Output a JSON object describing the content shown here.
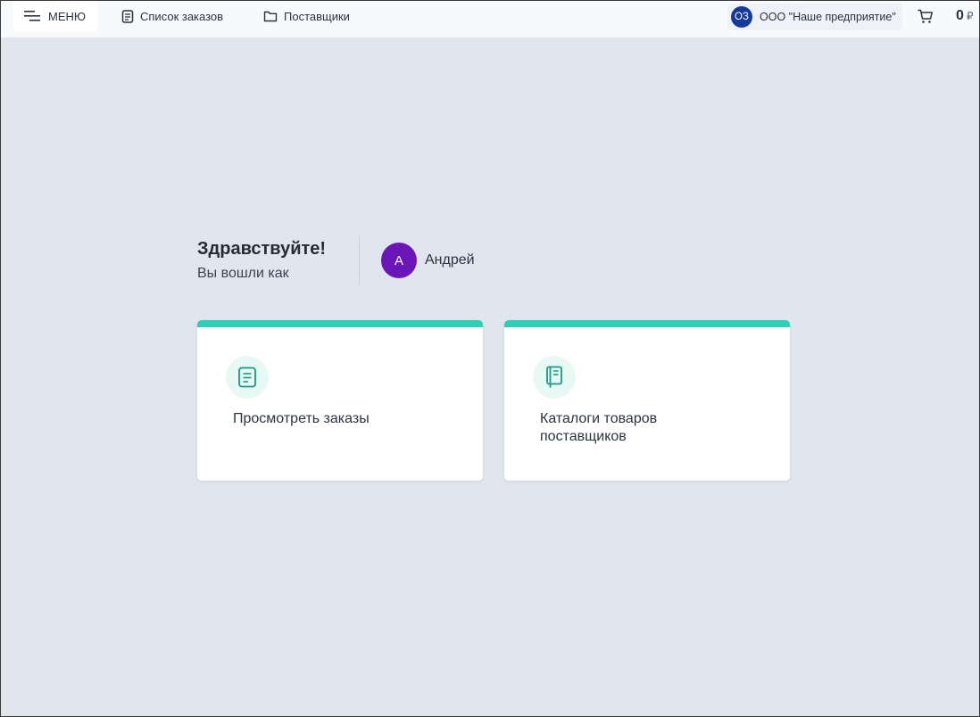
{
  "header": {
    "menu_label": "МЕНЮ",
    "nav": [
      {
        "label": "Список заказов",
        "icon": "document-icon"
      },
      {
        "label": "Поставщики",
        "icon": "folder-icon"
      }
    ],
    "org": {
      "initials": "ОЗ",
      "name": "ООО \"Наше предприятие\"",
      "avatar_color": "#163a9c"
    },
    "cart": {
      "icon": "cart-icon",
      "total": "0",
      "currency": "₽"
    }
  },
  "greeting": {
    "title": "Здравствуйте!",
    "subtitle": "Вы вошли как",
    "user": {
      "initial": "А",
      "name": "Андрей",
      "avatar_color": "#6a16b9"
    }
  },
  "cards": [
    {
      "label": "Просмотреть заказы",
      "icon": "document-icon"
    },
    {
      "label": "Каталоги товаров поставщиков",
      "icon": "catalog-book-icon"
    }
  ],
  "colors": {
    "accent": "#2ccfb7",
    "background": "#e1e6ee",
    "icon_teal": "#1a9a86"
  }
}
